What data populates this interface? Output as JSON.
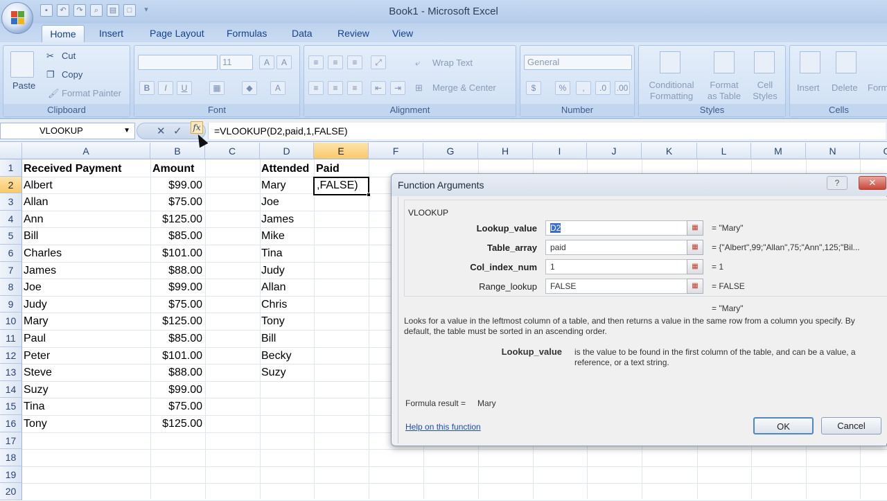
{
  "window": {
    "title": "Book1 - Microsoft Excel"
  },
  "ribbon": {
    "tabs": [
      "Home",
      "Insert",
      "Page Layout",
      "Formulas",
      "Data",
      "Review",
      "View"
    ],
    "clipboard": {
      "paste": "Paste",
      "cut": "Cut",
      "copy": "Copy",
      "format_painter": "Format Painter",
      "label": "Clipboard"
    },
    "font": {
      "size": "11",
      "label": "Font",
      "bold": "B",
      "italic": "I",
      "underline": "U"
    },
    "alignment": {
      "wrap_text": "Wrap Text",
      "merge_center": "Merge & Center",
      "label": "Alignment"
    },
    "number": {
      "format": "General",
      "label": "Number",
      "currency": "$",
      "percent": "%"
    },
    "styles": {
      "conditional": "Conditional",
      "formatting": "Formatting",
      "format": "Format",
      "as_table": "as Table",
      "cell": "Cell",
      "cell_styles": "Styles",
      "label": "Styles"
    },
    "cells": {
      "insert": "Insert",
      "delete": "Delete",
      "format": "Form",
      "label": "Cells"
    }
  },
  "formula_bar": {
    "name_box": "VLOOKUP",
    "cancel": "✕",
    "enter": "✓",
    "fx": "fx",
    "formula": "=VLOOKUP(D2,paid,1,FALSE)"
  },
  "columns": [
    "A",
    "B",
    "C",
    "D",
    "E",
    "F",
    "G",
    "H",
    "I",
    "J",
    "K",
    "L",
    "M",
    "N",
    "O"
  ],
  "rows": [
    "1",
    "2",
    "3",
    "4",
    "5",
    "6",
    "7",
    "8",
    "9",
    "10",
    "11",
    "12",
    "13",
    "14",
    "15",
    "16",
    "17",
    "18",
    "19",
    "20"
  ],
  "sheet": {
    "headers": {
      "a": "Received Payment",
      "b": "Amount",
      "d": "Attended",
      "e": "Paid"
    },
    "received": [
      "Albert",
      "Allan",
      "Ann",
      "Bill",
      "Charles",
      "James",
      "Joe",
      "Judy",
      "Mary",
      "Paul",
      "Peter",
      "Steve",
      "Suzy",
      "Tina",
      "Tony"
    ],
    "amounts": [
      "$99.00",
      "$75.00",
      "$125.00",
      "$85.00",
      "$101.00",
      "$88.00",
      "$99.00",
      "$75.00",
      "$125.00",
      "$85.00",
      "$101.00",
      "$88.00",
      "$99.00",
      "$75.00",
      "$125.00"
    ],
    "attended": [
      "Mary",
      "Joe",
      "James",
      "Mike",
      "Tina",
      "Judy",
      "Allan",
      "Chris",
      "Tony",
      "Bill",
      "Becky",
      "Suzy"
    ],
    "active_cell": ",FALSE)"
  },
  "dialog": {
    "title": "Function Arguments",
    "help_btn": "?",
    "close_btn": "✕",
    "function_name": "VLOOKUP",
    "args": [
      {
        "label": "Lookup_value",
        "value": "D2",
        "result": "=  \"Mary\""
      },
      {
        "label": "Table_array",
        "value": "paid",
        "result": "=  {\"Albert\",99;\"Allan\",75;\"Ann\",125;\"Bil..."
      },
      {
        "label": "Col_index_num",
        "value": "1",
        "result": "=  1"
      },
      {
        "label": "Range_lookup",
        "value": "FALSE",
        "result": "=  FALSE"
      }
    ],
    "total_result": "=  \"Mary\"",
    "description": "Looks for a value in the leftmost column of a table, and then returns a value in the same row from a column you specify. By default, the table must be sorted in an ascending order.",
    "arg_help_name": "Lookup_value",
    "arg_help_text": "is the value to be found in the first column of the table, and can be a value, a reference, or a text string.",
    "formula_result_label": "Formula result =",
    "formula_result": "Mary",
    "help_link": "Help on this function",
    "ok": "OK",
    "cancel": "Cancel"
  }
}
